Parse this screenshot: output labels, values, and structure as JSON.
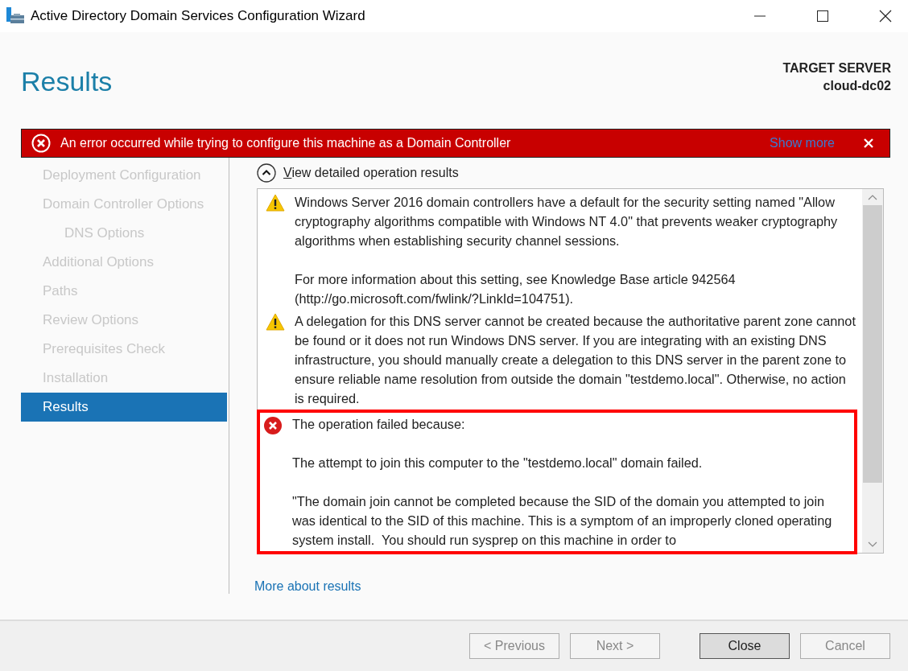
{
  "window": {
    "title": "Active Directory Domain Services Configuration Wizard"
  },
  "page_title": "Results",
  "target_server": {
    "label": "TARGET SERVER",
    "name": "cloud-dc02"
  },
  "error_banner": {
    "message": "An error occurred while trying to configure this machine as a Domain Controller",
    "link": "Show more"
  },
  "sidebar": {
    "items": [
      {
        "label": "Deployment Configuration",
        "selected": false
      },
      {
        "label": "Domain Controller Options",
        "selected": false,
        "children": [
          {
            "label": "DNS Options",
            "selected": false
          }
        ]
      },
      {
        "label": "Additional Options",
        "selected": false
      },
      {
        "label": "Paths",
        "selected": false
      },
      {
        "label": "Review Options",
        "selected": false
      },
      {
        "label": "Prerequisites Check",
        "selected": false
      },
      {
        "label": "Installation",
        "selected": false
      },
      {
        "label": "Results",
        "selected": true
      }
    ]
  },
  "details": {
    "toggle_label": "View detailed operation results",
    "expanded": true,
    "messages": [
      {
        "kind": "warning",
        "highlighted": false,
        "paragraphs": [
          "Windows Server 2016 domain controllers have a default for the security setting named \"Allow cryptography algorithms compatible with Windows NT 4.0\" that prevents weaker cryptography algorithms when establishing security channel sessions.",
          "For more information about this setting, see Knowledge Base article 942564 (http://go.microsoft.com/fwlink/?LinkId=104751)."
        ]
      },
      {
        "kind": "warning",
        "highlighted": false,
        "paragraphs": [
          "A delegation for this DNS server cannot be created because the authoritative parent zone cannot be found or it does not run Windows DNS server. If you are integrating with an existing DNS infrastructure, you should manually create a delegation to this DNS server in the parent zone to ensure reliable name resolution from outside the domain \"testdemo.local\". Otherwise, no action is required."
        ]
      },
      {
        "kind": "error",
        "highlighted": true,
        "paragraphs": [
          "The operation failed because:",
          "The attempt to join this computer to the \"testdemo.local\" domain failed.",
          "\"The domain join cannot be completed because the SID of the domain you attempted to join was identical to the SID of this machine. This is a symptom of an improperly cloned operating system install.  You should run sysprep on this machine in order to"
        ]
      }
    ]
  },
  "more_link": "More about results",
  "buttons": [
    {
      "label": "< Previous",
      "disabled": true,
      "default": false
    },
    {
      "label": "Next >",
      "disabled": true,
      "default": false
    },
    {
      "label": "Close",
      "disabled": false,
      "default": true
    },
    {
      "label": "Cancel",
      "disabled": true,
      "default": false
    }
  ]
}
